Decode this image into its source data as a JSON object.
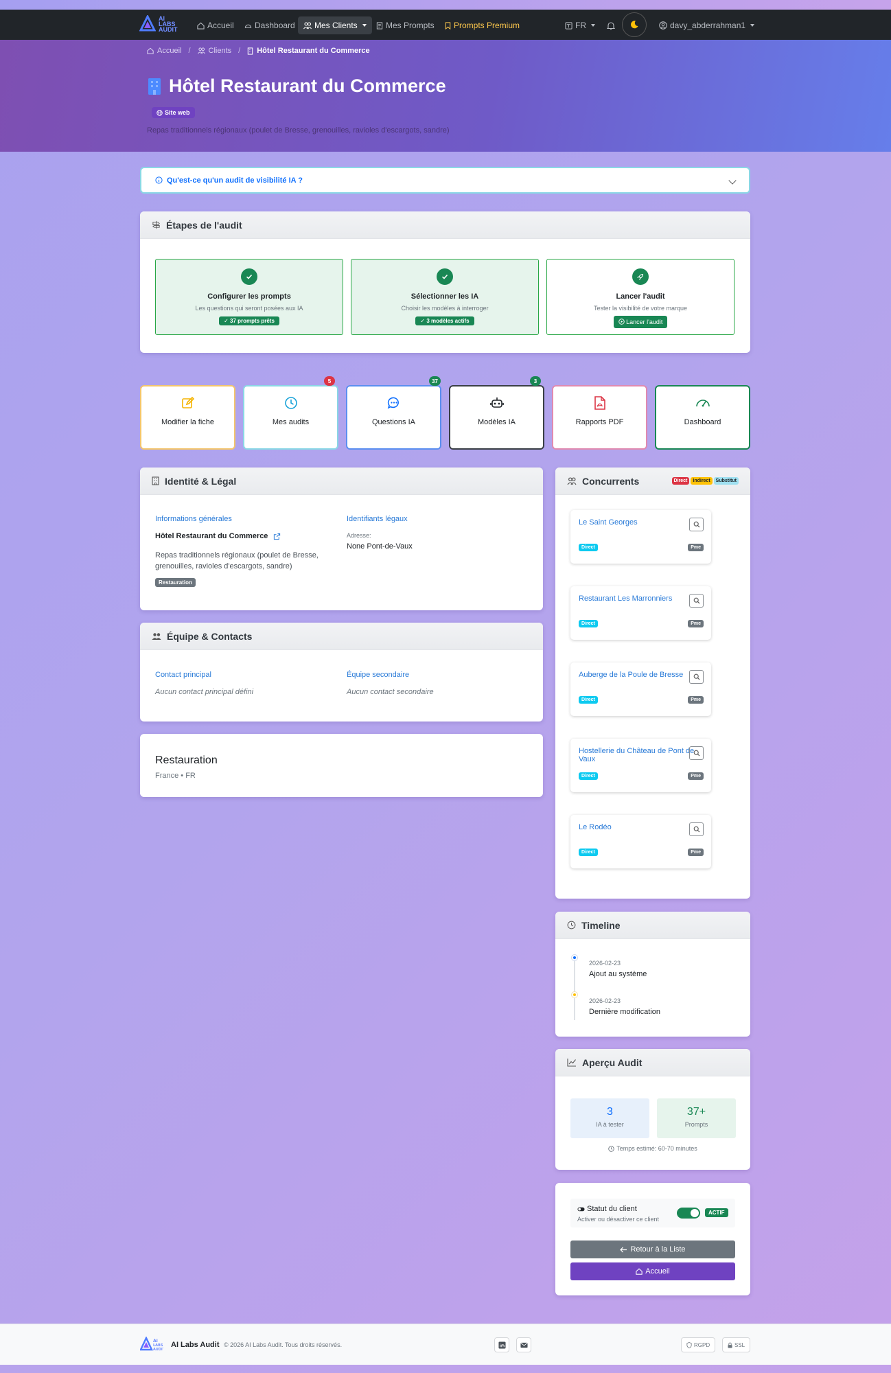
{
  "nav": {
    "brand_line1": "AI",
    "brand_line2": "LABS",
    "brand_line3": "AUDIT",
    "items": [
      {
        "label": "Accueil",
        "icon": "home-icon"
      },
      {
        "label": "Dashboard",
        "icon": "speedometer-icon"
      },
      {
        "label": "Mes Clients",
        "icon": "people-icon",
        "active": true
      },
      {
        "label": "Mes Prompts",
        "icon": "document-icon"
      },
      {
        "label": "Prompts Premium",
        "icon": "bookmark-icon"
      }
    ],
    "language": "FR",
    "user": "davy_abderrahman1"
  },
  "breadcrumb": {
    "home": "Accueil",
    "clients": "Clients",
    "current": "Hôtel Restaurant du Commerce"
  },
  "hero": {
    "title": "Hôtel Restaurant du Commerce",
    "badge": "Site web",
    "description": "Repas traditionnels régionaux (poulet de Bresse, grenouilles, ravioles d'escargots, sandre)"
  },
  "info_bar": {
    "label": "Qu'est-ce qu'un audit de visibilité IA ?"
  },
  "steps": {
    "title": "Étapes de l'audit",
    "items": [
      {
        "title": "Configurer les prompts",
        "subtitle": "Les questions qui seront posées aux IA",
        "badge": "✓ 37 prompts prêts"
      },
      {
        "title": "Sélectionner les IA",
        "subtitle": "Choisir les modèles à interroger",
        "badge": "✓ 3 modèles actifs"
      },
      {
        "title": "Lancer l'audit",
        "subtitle": "Tester la visibilité de votre marque",
        "button": "Lancer l'audit"
      }
    ]
  },
  "tiles": [
    {
      "label": "Modifier la fiche"
    },
    {
      "label": "Mes audits",
      "badge": "5"
    },
    {
      "label": "Questions IA",
      "badge": "37"
    },
    {
      "label": "Modèles IA",
      "badge": "3"
    },
    {
      "label": "Rapports PDF"
    },
    {
      "label": "Dashboard"
    }
  ],
  "identity": {
    "title": "Identité & Légal",
    "general_title": "Informations générales",
    "name": "Hôtel Restaurant du Commerce",
    "description": "Repas traditionnels régionaux (poulet de Bresse, grenouilles, ravioles d'escargots, sandre)",
    "category": "Restauration",
    "legal_title": "Identifiants légaux",
    "address_label": "Adresse:",
    "address_value": "None Pont-de-Vaux"
  },
  "team": {
    "title": "Équipe & Contacts",
    "primary_title": "Contact principal",
    "primary_value": "Aucun contact principal défini",
    "secondary_title": "Équipe secondaire",
    "secondary_value": "Aucun contact secondaire"
  },
  "sector": {
    "title": "Restauration",
    "subtitle": "France • FR"
  },
  "competitors": {
    "title": "Concurrents",
    "legend": [
      "Direct",
      "Indirect",
      "Substitut"
    ],
    "items": [
      {
        "name": "Le Saint Georges",
        "type": "Direct",
        "size": "Pme"
      },
      {
        "name": "Restaurant Les Marronniers",
        "type": "Direct",
        "size": "Pme"
      },
      {
        "name": "Auberge de la Poule de Bresse",
        "type": "Direct",
        "size": "Pme"
      },
      {
        "name": "Hostellerie du Château de Pont de Vaux",
        "type": "Direct",
        "size": "Pme"
      },
      {
        "name": "Le Rodéo",
        "type": "Direct",
        "size": "Pme"
      }
    ]
  },
  "timeline": {
    "title": "Timeline",
    "events": [
      {
        "date": "2026-02-23",
        "text": "Ajout au système"
      },
      {
        "date": "2026-02-23",
        "text": "Dernière modification"
      }
    ]
  },
  "overview": {
    "title": "Aperçu Audit",
    "ia_count": "3",
    "ia_label": "IA à tester",
    "prompts_count": "37+",
    "prompts_label": "Prompts",
    "estimate": "Temps estimé: 60-70 minutes"
  },
  "status": {
    "title": "Statut du client",
    "subtitle": "Activer ou désactiver ce client",
    "badge": "ACTIF",
    "back_button": "Retour à la Liste",
    "home_button": "Accueil"
  },
  "footer": {
    "brand": "AI Labs Audit",
    "copyright": "© 2026 AI Labs Audit. Tous droits réservés.",
    "tag_rgpd": "RGPD",
    "tag_ssl": "SSL"
  },
  "colors": {
    "green": "#198754",
    "purple": "#6f42c1",
    "blue_link": "#2a7bd8",
    "navbar": "#212529"
  }
}
